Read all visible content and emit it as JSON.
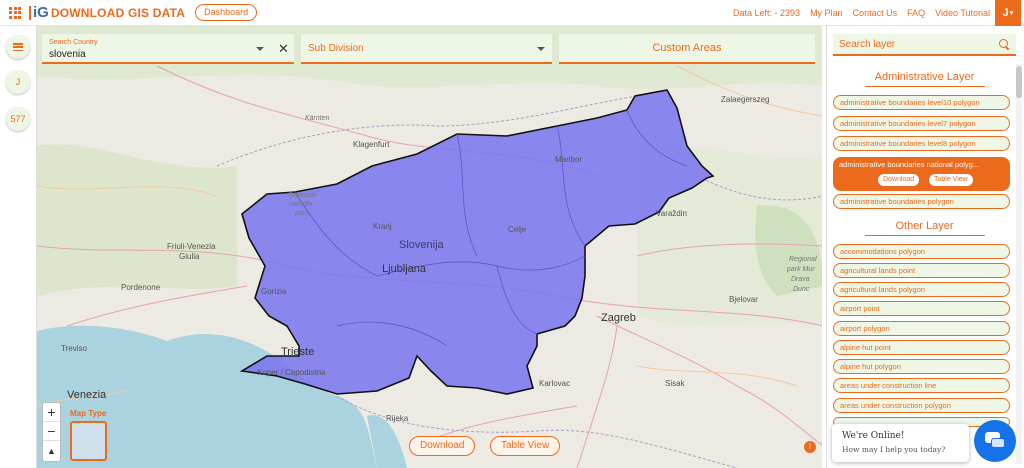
{
  "header": {
    "logo_mark": "iG",
    "logo_text": "DOWNLOAD GIS DATA",
    "dashboard_label": "Dashboard",
    "data_left": "Data Left: - 2393",
    "links": [
      "My Plan",
      "Contact Us",
      "FAQ",
      "Video Tutorial"
    ],
    "user_initial": "J",
    "user_caret": "▾",
    "grid_icon": "grid-icon"
  },
  "rail": {
    "user_initial": "J",
    "count": "577"
  },
  "search": {
    "country_label": "Search Country",
    "country_value": "slovenia",
    "clear_glyph": "✕",
    "subdivision_label": "Sub Division",
    "custom_areas_label": "Custom Areas"
  },
  "map": {
    "labels": {
      "karnten": "Kärnten",
      "klagenfurt": "Klagenfurt",
      "zalaegerszeg": "Zalaegerszeg",
      "maribor": "Maribor",
      "triglavski": "Triglavski",
      "narodni": "narodni",
      "park": "park",
      "kranj": "Kranj",
      "slovenija": "Slovenija",
      "celje": "Celje",
      "ljubljana": "Ljubljana",
      "varazdin": "Varaždin",
      "friuli1": "Friuli-Venezia",
      "friuli2": "Giulia",
      "pordenone": "Pordenone",
      "gorizia": "Gorizia",
      "trieste": "Trieste",
      "koper": "Koper / Capodistria",
      "treviso": "Treviso",
      "venezia": "Venezia",
      "zagreb": "Zagreb",
      "bjelovar": "Bjelovar",
      "karlovac": "Karlovac",
      "sisak": "Sisak",
      "rijeka": "Rijeka",
      "regional1": "Regional",
      "regional2": "park Mur",
      "regional3": "Drava",
      "regional4": "Dunc"
    },
    "zoom_in": "+",
    "zoom_out": "−",
    "reset": "▲",
    "map_type_label": "Map Type",
    "download_label": "Download",
    "table_view_label": "Table View",
    "info_glyph": "i"
  },
  "panel": {
    "search_placeholder": "Search layer",
    "admin_title": "Administrative Layer",
    "admin_layers": [
      "administrative boundaries level10 polygon",
      "administrative boundaries level7 polygon",
      "administrative boundaries level8 polygon",
      "administrative boundaries national polyg...",
      "administrative boundaries polygon"
    ],
    "active_download": "Download",
    "active_table_view": "Table View",
    "other_title": "Other Layer",
    "other_layers": [
      "accommodations polygon",
      "agricultural lands point",
      "agricultural lands polygon",
      "airport point",
      "airport polygon",
      "alpine hut point",
      "alpine hut polygon",
      "areas under construction line",
      "areas under construction polygon"
    ]
  },
  "chat": {
    "line1": "We're Online!",
    "line2": "How may I help you today?"
  },
  "colors": {
    "accent": "#ec6a1c",
    "panel_bg": "#eef7e6",
    "country_fill": "#7b78ef",
    "chat_blue": "#1572e8"
  }
}
